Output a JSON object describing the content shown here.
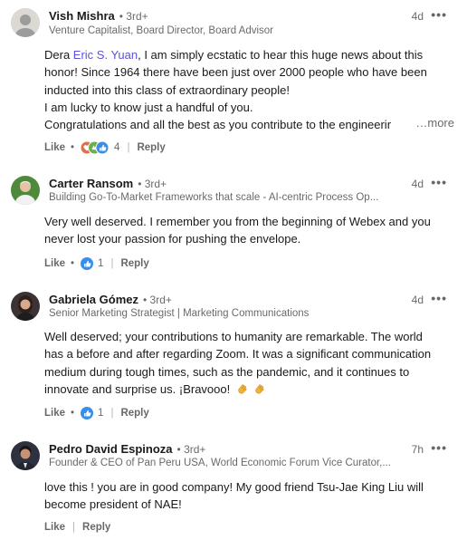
{
  "comments": [
    {
      "name": "Vish Mishra",
      "degree": "• 3rd+",
      "headline": "Venture Capitalist, Board Director, Board Advisor",
      "time": "4d",
      "lines": [
        {
          "pre": "Dera ",
          "mention": "Eric S. Yuan",
          "post": ", I am simply ecstatic to hear this huge news about this"
        },
        {
          "text": "honor! Since 1964 there have been just over 2000 people who have been"
        },
        {
          "text": "inducted into this class of extraordinary people!"
        },
        {
          "text": "I am lucky to know just a handful of you."
        },
        {
          "text": "Congratulations and all the best as you contribute to the engineerir"
        }
      ],
      "more": "…more",
      "like": "Like",
      "reaction_count": "4",
      "reactions": [
        "love-icon",
        "clap-icon",
        "like-icon"
      ],
      "reply": "Reply"
    },
    {
      "name": "Carter Ransom",
      "degree": "• 3rd+",
      "headline": "Building Go-To-Market Frameworks that scale - AI-centric Process Op...",
      "time": "4d",
      "lines": [
        {
          "text": "Very well deserved. I remember you from the beginning of Webex and you"
        },
        {
          "text": "never lost your passion for pushing the envelope."
        }
      ],
      "like": "Like",
      "reaction_count": "1",
      "reactions": [
        "like-icon"
      ],
      "reply": "Reply"
    },
    {
      "name": "Gabriela Gómez",
      "degree": "• 3rd+",
      "headline": "Senior Marketing Strategist | Marketing Communications",
      "time": "4d",
      "lines": [
        {
          "text": "Well deserved; your contributions to humanity are remarkable. The world"
        },
        {
          "text": "has a before and after regarding Zoom. It was a significant communication"
        },
        {
          "text": "medium during tough times, such as the pandemic, and it continues to"
        },
        {
          "text": "innovate and surprise us. ¡Bravooo!"
        }
      ],
      "like": "Like",
      "reaction_count": "1",
      "reactions": [
        "like-icon"
      ],
      "reply": "Reply"
    },
    {
      "name": "Pedro David Espinoza",
      "degree": "• 3rd+",
      "headline": "Founder & CEO of Pan Peru USA, World Economic Forum Vice Curator,...",
      "time": "7h",
      "lines": [
        {
          "text": "love this ! you are in good company! My good friend Tsu-Jae King Liu will"
        },
        {
          "text": "become president of NAE!"
        }
      ],
      "like": "Like",
      "reply": "Reply"
    }
  ],
  "ui": {
    "dots": "•••",
    "bar": "|",
    "dot_sep": "•"
  },
  "colors": {
    "mention": "#5b53d4",
    "like_blue": "#378fe9",
    "love_red": "#df704d",
    "clap_green": "#6dae4f"
  }
}
